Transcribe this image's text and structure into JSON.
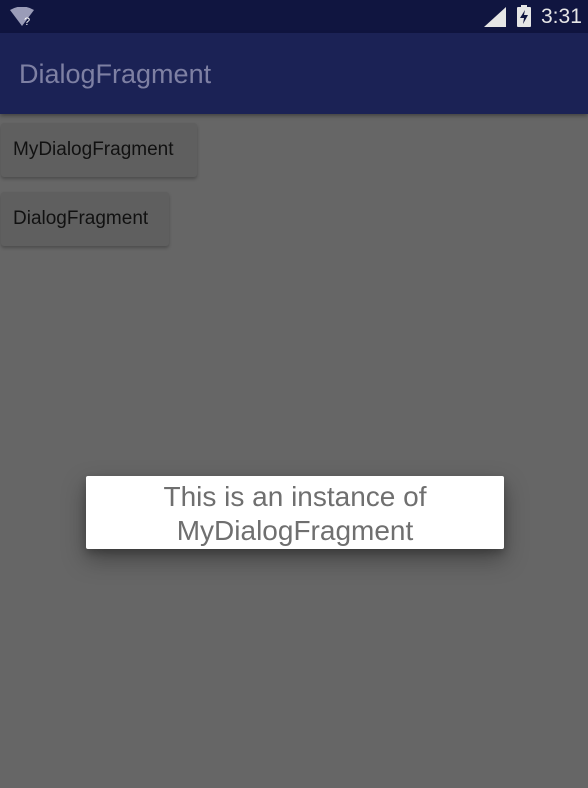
{
  "status_bar": {
    "time": "3:31",
    "wifi_icon": "wifi-unknown-icon",
    "wifi_badge": "?",
    "signal_icon": "cell-signal-icon",
    "battery_icon": "battery-charging-icon"
  },
  "app_bar": {
    "title": "DialogFragment"
  },
  "buttons": [
    {
      "label": "MyDialogFragment"
    },
    {
      "label": "DialogFragment"
    }
  ],
  "dialog": {
    "line1": "This is an instance of",
    "line2": "MyDialogFragment"
  },
  "colors": {
    "status_bar": "#101540",
    "app_bar": "#1b2255",
    "scrim": "#666666",
    "dialog_bg": "#ffffff",
    "dialog_text": "#6f6f6f"
  }
}
